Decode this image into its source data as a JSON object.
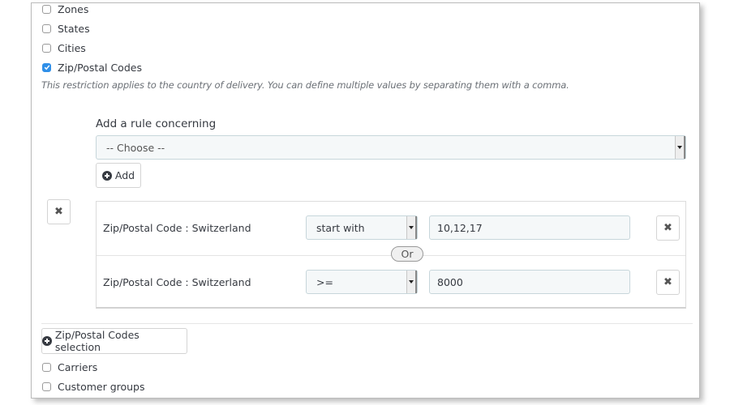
{
  "restrictions": {
    "top_checkboxes": [
      {
        "label": "Zones",
        "checked": false
      },
      {
        "label": "States",
        "checked": false
      },
      {
        "label": "Cities",
        "checked": false
      },
      {
        "label": "Zip/Postal Codes",
        "checked": true
      }
    ],
    "help_text": "This restriction applies to the country of delivery. You can define multiple values by separating them with a comma.",
    "bottom_checkboxes": [
      {
        "label": "Carriers",
        "checked": false
      },
      {
        "label": "Customer groups",
        "checked": false
      }
    ]
  },
  "rule_builder": {
    "label": "Add a rule concerning",
    "select_value": "-- Choose --",
    "add_button": "Add",
    "or_label": "Or",
    "rules": [
      {
        "name": "Zip/Postal Code : Switzerland",
        "operator": "start with",
        "value": "10,12,17"
      },
      {
        "name": "Zip/Postal Code : Switzerland",
        "operator": ">=",
        "value": "8000"
      }
    ]
  },
  "selection_button": "Zip/Postal Codes selection",
  "icons": {
    "remove_group": "close-icon",
    "remove_rule": "close-icon",
    "add": "plus-circle-icon",
    "dropdown": "caret-down-icon",
    "checked": "checkmark-icon"
  }
}
